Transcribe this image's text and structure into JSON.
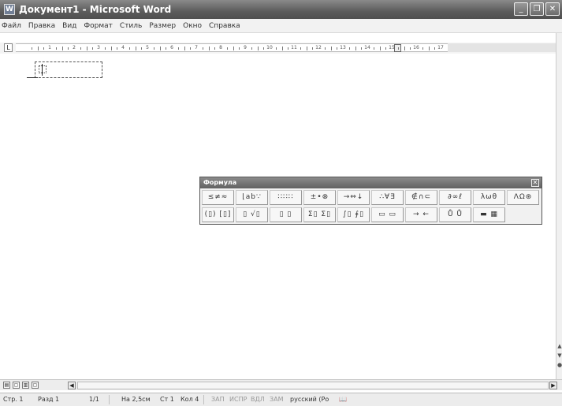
{
  "window": {
    "title": "Документ1 - Microsoft Word",
    "minimize_glyph": "_",
    "restore_glyph": "❐",
    "close_glyph": "✕"
  },
  "menu": [
    "Файл",
    "Правка",
    "Вид",
    "Формат",
    "Стиль",
    "Размер",
    "Окно",
    "Справка"
  ],
  "ruler": {
    "numbers": [
      "1",
      "2",
      "3",
      "4",
      "5",
      "6",
      "7",
      "8",
      "9",
      "10",
      "11",
      "12",
      "13",
      "14",
      "15",
      "16",
      "17"
    ],
    "tab_selector_glyph": "L"
  },
  "formula_toolbar": {
    "title": "Формула",
    "close_glyph": "✕",
    "row1": [
      "≤≠≈",
      "⌊ab∵",
      "∷∷∷",
      "±•⊗",
      "→⇔↓",
      "∴∀∃",
      "∉∩⊂",
      "∂∞ℓ",
      "λωθ",
      "ΛΩ⊛"
    ],
    "row2": [
      "(▯) [▯]",
      "▯ √▯",
      "▯ ▯",
      "Σ▯ Σ▯",
      "∫▯ ∮▯",
      "▭ ▭",
      "→ ←",
      "Ů Ů",
      "▬ ▦"
    ]
  },
  "view_buttons": [
    "▤",
    "▢",
    "▥",
    "▢"
  ],
  "status": {
    "page": "Стр. 1",
    "section": "Разд 1",
    "pages": "1/1",
    "at": "На 2,5см",
    "line": "Ст 1",
    "col": "Кол 4",
    "rec": "ЗАП",
    "trk": "ИСПР",
    "ext": "ВДЛ",
    "ovr": "ЗАМ",
    "language": "русский (Ро",
    "book_glyph": "📖"
  }
}
